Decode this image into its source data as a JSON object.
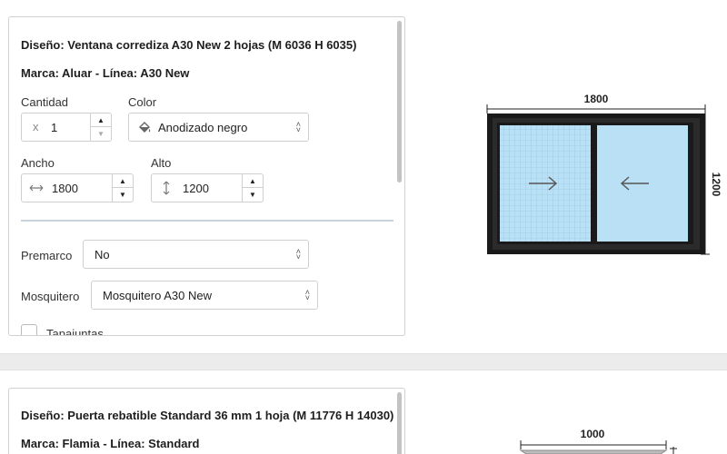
{
  "items": [
    {
      "design": "Diseño: Ventana corrediza A30 New 2 hojas (M 6036 H 6035)",
      "brand": "Marca: Aluar - Línea: A30 New",
      "quantity": {
        "label": "Cantidad",
        "prefix": "x",
        "value": "1"
      },
      "color": {
        "label": "Color",
        "value": "Anodizado negro"
      },
      "width": {
        "label": "Ancho",
        "value": "1800"
      },
      "height": {
        "label": "Alto",
        "value": "1200"
      },
      "premarco": {
        "label": "Premarco",
        "value": "No"
      },
      "mosquitero": {
        "label": "Mosquitero",
        "value": "Mosquitero A30 New"
      },
      "tapajuntas": {
        "label": "Tapajuntas"
      },
      "dims": {
        "width": "1800",
        "height": "1200"
      }
    },
    {
      "design": "Diseño: Puerta rebatible Standard 36 mm 1 hoja (M 11776 H 14030)",
      "brand": "Marca: Flamia - Línea: Standard",
      "dims": {
        "width": "1000"
      }
    }
  ],
  "colors": {
    "frame": "#1a1a1a",
    "glass": "#b9e0f5",
    "mesh": "#7fb8d8",
    "separator": "#c9d3dd"
  },
  "icons": {
    "paint": "paint-bucket-icon",
    "width": "horizontal-arrows-icon",
    "height": "vertical-arrows-icon"
  }
}
